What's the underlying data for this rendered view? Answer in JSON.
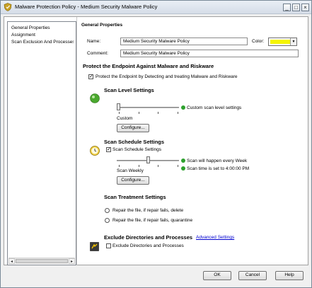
{
  "window": {
    "title": "Malware Protection Policy - Medium Security Malware Policy",
    "controls": {
      "minimize": "_",
      "maximize": "□",
      "close": "×"
    }
  },
  "sidebar": {
    "items": [
      {
        "label": "General Properties"
      },
      {
        "label": "Assignment"
      },
      {
        "label": "Scan Exclusion And Processes"
      }
    ]
  },
  "general": {
    "header": "General Properties",
    "name_label": "Name:",
    "name_value": "Medium Security Malware Policy",
    "color_label": "Color:",
    "color_value": "#f5f500",
    "comment_label": "Comment:",
    "comment_value": "Medium Security Malware Policy"
  },
  "protect": {
    "title": "Protect the Endpoint Against Malware and Riskware",
    "checkbox_label": "Protect the Endpoint by Detecting and treating Malware and Riskware",
    "checked": true
  },
  "scan_level": {
    "title": "Scan Level Settings",
    "status": "Custom scan level settings",
    "slider_label": "Custom",
    "configure_label": "Configure..."
  },
  "scan_schedule": {
    "title": "Scan Schedule Settings",
    "checkbox_label": "Scan Schedule Settings",
    "checked": true,
    "status_1": "Scan will happen every Week",
    "status_2": "Scan time is set to 4:00:00 PM",
    "slider_label": "Scan Weekly",
    "configure_label": "Configure..."
  },
  "scan_treatment": {
    "title": "Scan Treatment Settings",
    "option_1": "Repair the file, if repair fails, delete",
    "option_2": "Repair the file, if repair fails, quarantine"
  },
  "exclude": {
    "title": "Exclude Directories and Processes",
    "link": "Advanced Settings",
    "checkbox_label": "Exclude Directories and Processes",
    "checked": false
  },
  "footer": {
    "ok": "OK",
    "cancel": "Cancel",
    "help": "Help"
  },
  "colors": {
    "status_ok": "#2ea12e",
    "link": "#0000d0"
  }
}
